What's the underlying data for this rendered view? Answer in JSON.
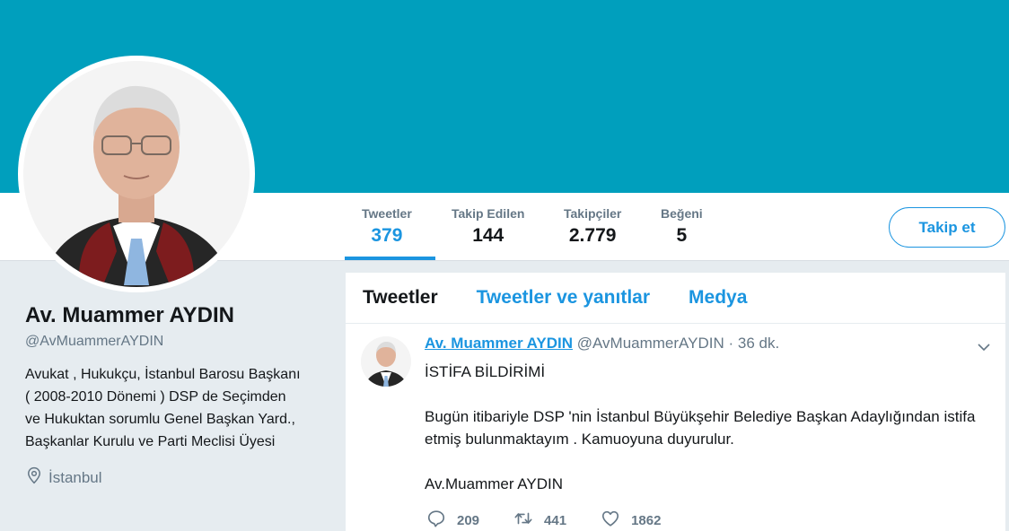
{
  "profile": {
    "name": "Av. Muammer AYDIN",
    "handle": "@AvMuammerAYDIN",
    "bio": "Avukat , Hukukçu, İstanbul Barosu Başkanı ( 2008-2010 Dönemi ) DSP de Seçimden ve Hukuktan sorumlu Genel Başkan Yard., Başkanlar Kurulu ve Parti Meclisi Üyesi",
    "location": "İstanbul"
  },
  "stats": [
    {
      "label": "Tweetler",
      "value": "379"
    },
    {
      "label": "Takip Edilen",
      "value": "144"
    },
    {
      "label": "Takipçiler",
      "value": "2.779"
    },
    {
      "label": "Beğeni",
      "value": "5"
    }
  ],
  "follow_button": "Takip et",
  "tabs": [
    {
      "label": "Tweetler"
    },
    {
      "label": "Tweetler ve yanıtlar"
    },
    {
      "label": "Medya"
    }
  ],
  "tweet": {
    "name": "Av. Muammer AYDIN",
    "handle": "@AvMuammerAYDIN",
    "separator": "·",
    "time": "36 dk.",
    "line1": "İSTİFA BİLDİRİMİ",
    "line2": "Bugün itibariyle DSP 'nin İstanbul Büyükşehir Belediye Başkan Adaylığından istifa etmiş bulunmaktayım . Kamuoyuna duyurulur.",
    "line3": "Av.Muammer AYDIN",
    "replies": "209",
    "retweets": "441",
    "likes": "1862"
  },
  "colors": {
    "banner": "#009fbd",
    "accent": "#1b95e0",
    "muted": "#657786",
    "page_bg": "#e6ecf0"
  },
  "icons": {
    "location": "map-pin-icon",
    "reply": "reply-icon",
    "retweet": "retweet-icon",
    "like": "heart-icon",
    "menu": "chevron-down-icon"
  }
}
